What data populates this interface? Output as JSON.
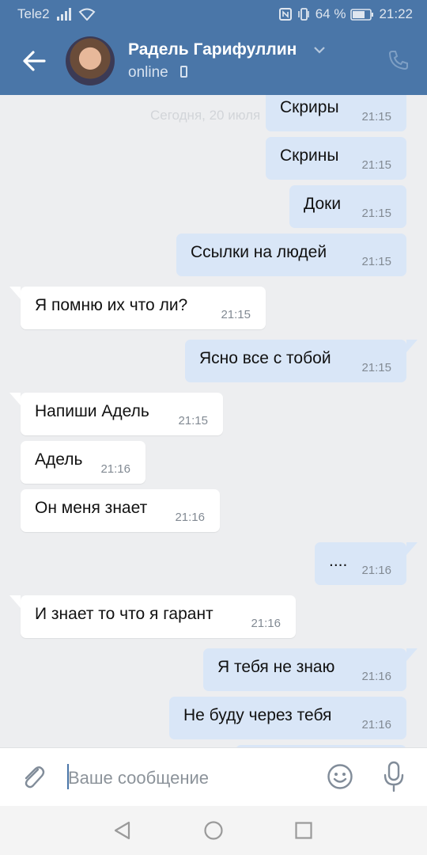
{
  "status_bar": {
    "carrier": "Tele2",
    "battery": "64 %",
    "time": "21:22"
  },
  "header": {
    "contact_name": "Радель Гарифуллин",
    "status": "online"
  },
  "chat": {
    "date_separator": "Сегодня, 20 июля",
    "messages": [
      {
        "dir": "out",
        "text": "Скриры",
        "time": "21:15"
      },
      {
        "dir": "out",
        "text": "Скрины",
        "time": "21:15"
      },
      {
        "dir": "out",
        "text": "Доки",
        "time": "21:15"
      },
      {
        "dir": "out",
        "text": "Ссылки на людей",
        "time": "21:15"
      },
      {
        "dir": "in",
        "text": "Я помню их что ли?",
        "time": "21:15"
      },
      {
        "dir": "out",
        "text": "Ясно все с тобой",
        "time": "21:15"
      },
      {
        "dir": "in",
        "text": "Напиши Адель",
        "time": "21:15"
      },
      {
        "dir": "in",
        "text": "Адель",
        "time": "21:16"
      },
      {
        "dir": "in",
        "text": "Он меня знает",
        "time": "21:16"
      },
      {
        "dir": "out",
        "text": "....",
        "time": "21:16"
      },
      {
        "dir": "in",
        "text": "И знает то что я гарант",
        "time": "21:16"
      },
      {
        "dir": "out",
        "text": "Я тебя не знаю",
        "time": "21:16"
      },
      {
        "dir": "out",
        "text": "Не буду через тебя",
        "time": "21:16"
      }
    ]
  },
  "composer": {
    "placeholder": "Ваше сообщение"
  },
  "icons": {
    "back": "arrow-left-icon",
    "call": "phone-icon",
    "attach": "paperclip-icon",
    "emoji": "smiley-icon",
    "mic": "microphone-icon"
  },
  "colors": {
    "brand": "#4a76a8",
    "outgoing_bubble": "#d9e6f7",
    "incoming_bubble": "#ffffff",
    "background": "#edeef0"
  }
}
